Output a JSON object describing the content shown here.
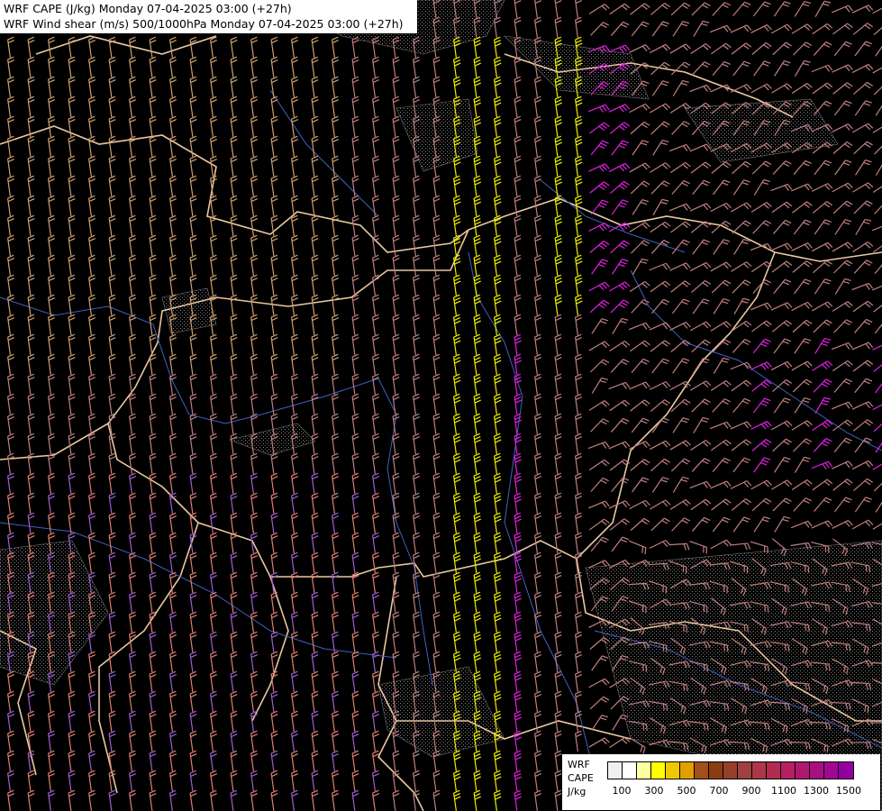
{
  "title_line1": "WRF CAPE (J/kg) Monday 07-04-2025 03:00 (+27h)",
  "title_line2": "WRF Wind shear (m/s) 500/1000hPa Monday 07-04-2025 03:00 (+27h)",
  "legend": {
    "line1": "WRF",
    "line2": "CAPE",
    "line3": "J/kg",
    "tick_labels": [
      "100",
      "300",
      "500",
      "700",
      "900",
      "1100",
      "1300",
      "1500"
    ],
    "colors": [
      "#f0f0f0",
      "#ffffff",
      "#ffffa0",
      "#ffff00",
      "#f0c800",
      "#e0a000",
      "#a05018",
      "#8c3c14",
      "#96402c",
      "#a04040",
      "#aa3848",
      "#b02c50",
      "#b42060",
      "#b01870",
      "#a81080",
      "#a00890",
      "#9400a0"
    ]
  },
  "barb_colors": {
    "neutral": "#c08080",
    "light": "#d0a070",
    "yellow": "#f0f000",
    "magenta": "#e020e0",
    "purple": "#a060d0",
    "salmon": "#e08070"
  },
  "map_colors": {
    "background": "#000000",
    "borders": "#e8c8a0",
    "rivers": "#4060c0",
    "terrain_stipple": "#808080"
  }
}
